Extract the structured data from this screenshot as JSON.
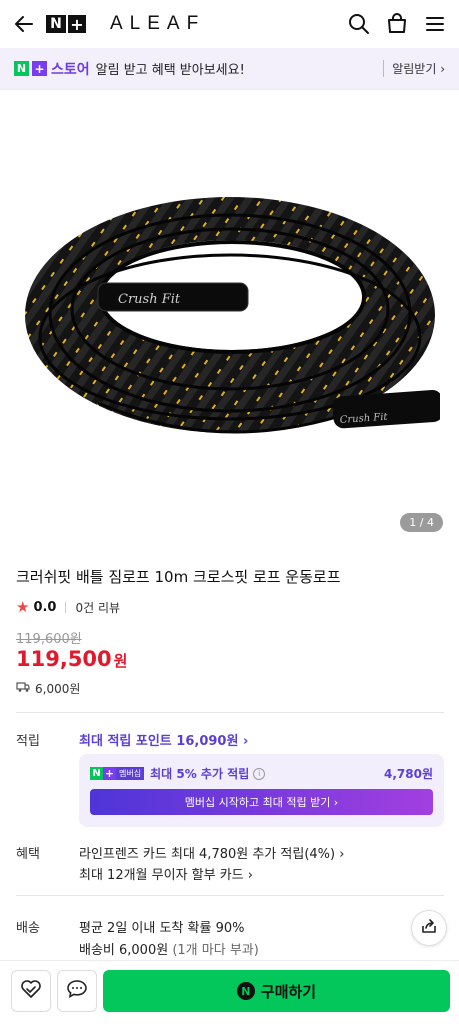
{
  "header": {
    "badge_n": "N",
    "badge_plus": "+",
    "brand": "ALEAF",
    "icons": [
      "back-arrow-icon",
      "search-icon",
      "cart-icon",
      "menu-icon"
    ]
  },
  "banner": {
    "badge_n": "N",
    "badge_plus": "+",
    "store_name": "스토어",
    "message": "알림 받고 혜택 받아보세요!",
    "action": "알림받기 ›"
  },
  "image": {
    "rope_text_1": "Crush Fit",
    "rope_text_2": "Crush Fit",
    "counter": "1 / 4"
  },
  "product": {
    "title": "크러쉬핏 배틀 짐로프 10m 크로스핏 로프 운동로프",
    "rating": "0.0",
    "reviews": "0건 리뷰",
    "original_price": "119,600원",
    "price": "119,500",
    "price_unit": "원",
    "shipping_fee": "6,000원"
  },
  "points": {
    "label": "적립",
    "max": "최대 적립 포인트 16,090원 ›",
    "membership_badge": "멤버십",
    "extra": "최대 5% 추가 적립",
    "info": "i",
    "extra_amount": "4,780원",
    "cta": "멤버십 시작하고 최대 적립 받기 ›"
  },
  "benefits": {
    "label": "혜택",
    "line1": "라인프렌즈 카드 최대 4,780원 추가 적립(4%) ›",
    "line2": "최대 12개월 무이자 할부 카드 ›"
  },
  "delivery": {
    "label": "배송",
    "line1": "평균 2일 이내 도착 확률 90%",
    "line2": "배송비 6,000원",
    "line2_note": "(1개 마다 부과)"
  },
  "bottom": {
    "buy_label": "구매하기",
    "buy_badge": "N"
  },
  "colors": {
    "brand_green": "#03c75a",
    "accent_purple": "#5b3ed6",
    "price_red": "#e01a2c"
  }
}
